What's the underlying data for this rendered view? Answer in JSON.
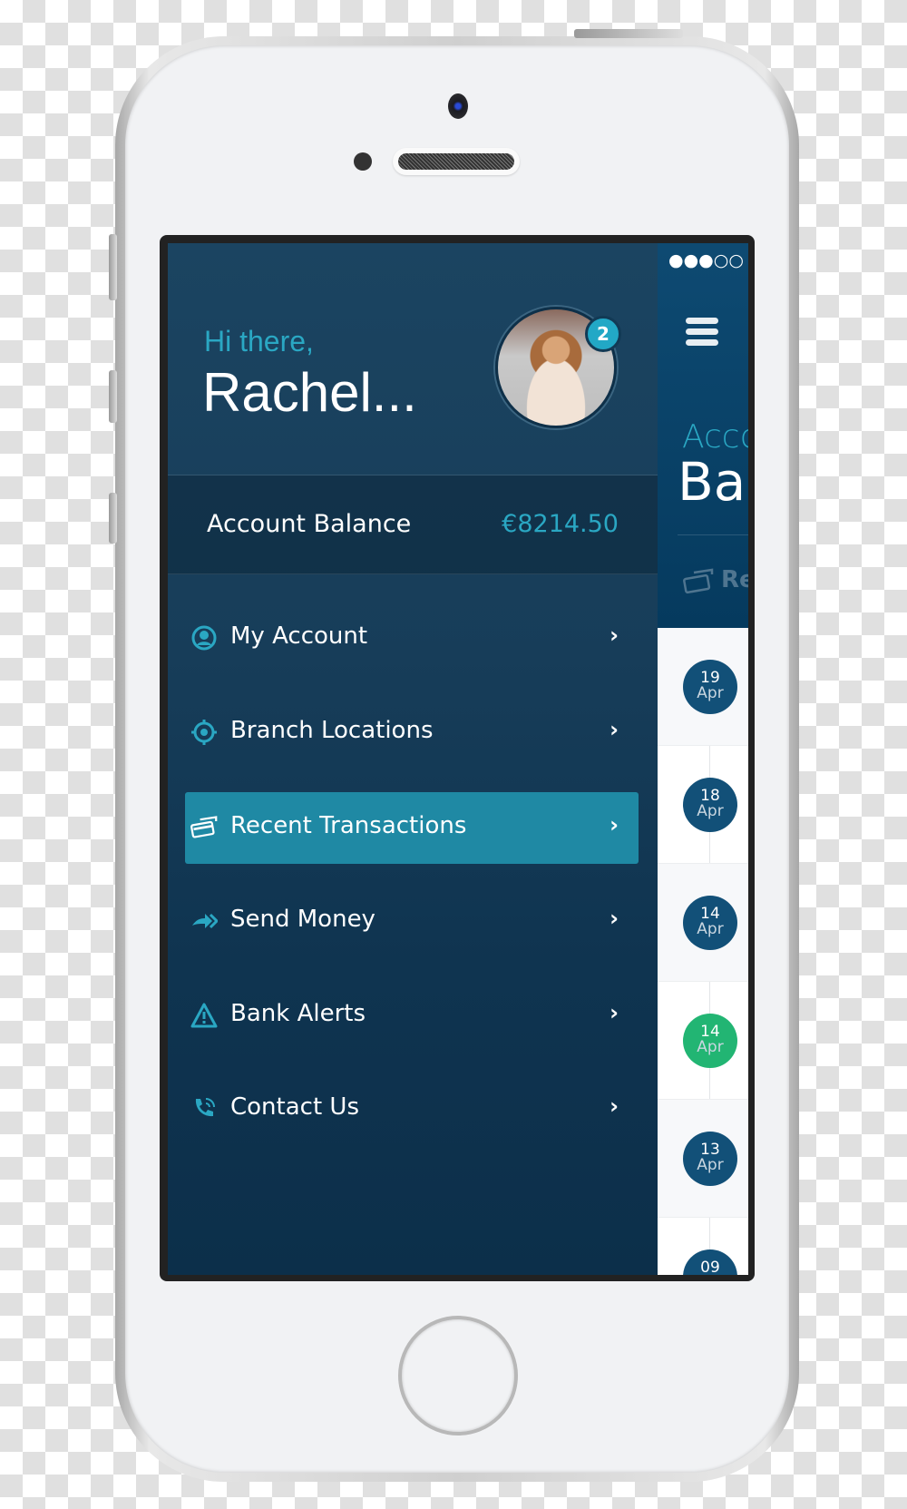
{
  "greeting": {
    "line1": "Hi there,",
    "name": "Rachel...",
    "notification_count": "2"
  },
  "balance": {
    "label": "Account Balance",
    "value": "€8214.50"
  },
  "menu": {
    "items": [
      {
        "label": "My Account",
        "icon": "user-circle-icon",
        "active": false
      },
      {
        "label": "Branch Locations",
        "icon": "target-location-icon",
        "active": false
      },
      {
        "label": "Recent Transactions",
        "icon": "credit-cards-icon",
        "active": true
      },
      {
        "label": "Send Money",
        "icon": "send-arrow-icon",
        "active": false
      },
      {
        "label": "Bank Alerts",
        "icon": "warning-triangle-icon",
        "active": false
      },
      {
        "label": "Contact Us",
        "icon": "phone-icon",
        "active": false
      }
    ],
    "chevron": "›"
  },
  "main": {
    "status": "●●●○○ eM",
    "title_small": "Acco",
    "title_large": "Bal",
    "tab_label": "Re",
    "transactions": [
      {
        "day": "19",
        "month": "Apr",
        "color": "#125078"
      },
      {
        "day": "18",
        "month": "Apr",
        "color": "#125078"
      },
      {
        "day": "14",
        "month": "Apr",
        "color": "#125078"
      },
      {
        "day": "14",
        "month": "Apr",
        "color": "#22b573"
      },
      {
        "day": "13",
        "month": "Apr",
        "color": "#125078"
      },
      {
        "day": "09",
        "month": "Apr",
        "color": "#125078"
      }
    ]
  },
  "colors": {
    "accent": "#2aa7c3",
    "active_item": "#1f89a4",
    "date_badge": "#125078",
    "credit_badge": "#22b573"
  }
}
